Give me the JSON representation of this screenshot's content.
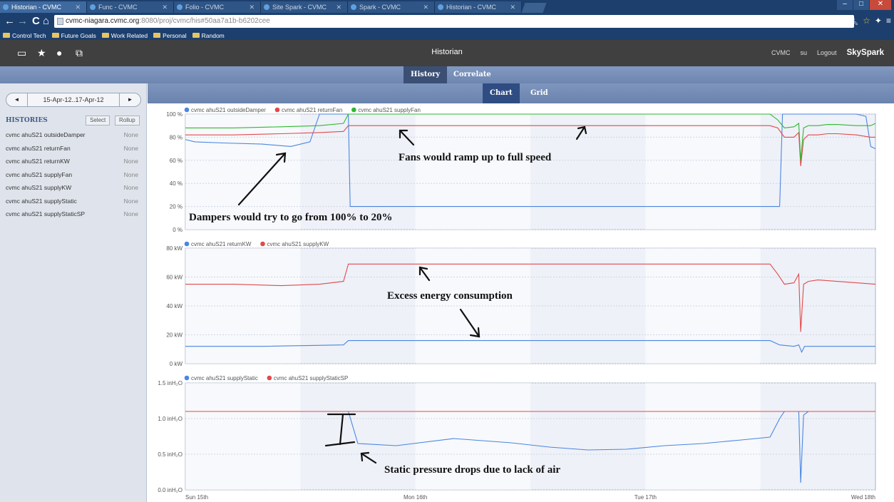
{
  "browser": {
    "tabs": [
      "Historian - CVMC",
      "Func - CVMC",
      "Folio - CVMC",
      "Site Spark - CVMC",
      "Spark - CVMC",
      "Historian - CVMC"
    ],
    "url_host": "cvmc-niagara.cvmc.org",
    "url_path": ":8080/proj/cvmc/his#50aa7a1b-b6202cee",
    "bookmarks": [
      "Control Tech",
      "Future Goals",
      "Work Related",
      "Personal",
      "Random"
    ]
  },
  "app": {
    "title": "Historian",
    "project": "CVMC",
    "user": "su",
    "logout": "Logout",
    "brand": "SkySpark",
    "mode_tabs": [
      "History",
      "Correlate"
    ],
    "view_tabs": [
      "Chart",
      "Grid"
    ]
  },
  "sidebar": {
    "date_range": "15-Apr-12..17-Apr-12",
    "histories_title": "HISTORIES",
    "select_label": "Select",
    "rollup_label": "Rollup",
    "items": [
      {
        "name": "cvmc ahuS21 outsideDamper",
        "rollup": "None"
      },
      {
        "name": "cvmc ahuS21 returnFan",
        "rollup": "None"
      },
      {
        "name": "cvmc ahuS21 returnKW",
        "rollup": "None"
      },
      {
        "name": "cvmc ahuS21 supplyFan",
        "rollup": "None"
      },
      {
        "name": "cvmc ahuS21 supplyKW",
        "rollup": "None"
      },
      {
        "name": "cvmc ahuS21 supplyStatic",
        "rollup": "None"
      },
      {
        "name": "cvmc ahuS21 supplyStaticSP",
        "rollup": "None"
      }
    ]
  },
  "colors": {
    "blue": "#4a86e0",
    "red": "#e04a4a",
    "green": "#2fb82f"
  },
  "chart_data": [
    {
      "type": "line",
      "ylim": [
        0,
        100
      ],
      "yticks": [
        "0 %",
        "20 %",
        "40 %",
        "60 %",
        "80 %",
        "100 %"
      ],
      "xlim": [
        0,
        72
      ],
      "series": [
        {
          "name": "cvmc ahuS21 outsideDamper",
          "color": "#4a86e0",
          "x": [
            0,
            1,
            4,
            8,
            11,
            13,
            14,
            15,
            16.5,
            17,
            17.2,
            18,
            26,
            34,
            42,
            50,
            58,
            62,
            62.3,
            62.6,
            63,
            64,
            66,
            67,
            68,
            69,
            70,
            71,
            71.5,
            72
          ],
          "y": [
            78,
            76,
            75,
            74,
            72,
            76,
            100,
            100,
            100,
            100,
            20,
            20,
            20,
            20,
            20,
            20,
            20,
            20,
            100,
            100,
            100,
            100,
            100,
            100,
            100,
            100,
            100,
            98,
            72,
            70
          ]
        },
        {
          "name": "cvmc ahuS21 returnFan",
          "color": "#e04a4a",
          "x": [
            0,
            5,
            10,
            14,
            16.5,
            17,
            30,
            45,
            61,
            61.8,
            62.5,
            63.5,
            64,
            64.2,
            64.5,
            65,
            66,
            67,
            68,
            70,
            71.5,
            72
          ],
          "y": [
            82,
            82,
            83,
            84,
            85,
            90,
            90,
            90,
            90,
            88,
            80,
            80,
            84,
            55,
            78,
            82,
            82,
            83,
            83,
            82,
            80,
            80
          ]
        },
        {
          "name": "cvmc ahuS21 supplyFan",
          "color": "#2fb82f",
          "x": [
            0,
            5,
            10,
            14,
            16.5,
            17,
            30,
            45,
            61,
            61.8,
            62.5,
            63.5,
            64,
            64.2,
            64.5,
            65,
            66,
            67,
            68,
            70,
            71.5,
            72
          ],
          "y": [
            88,
            88,
            89,
            90,
            92,
            100,
            100,
            100,
            100,
            95,
            88,
            89,
            92,
            60,
            88,
            90,
            90,
            91,
            91,
            90,
            90,
            92
          ]
        }
      ]
    },
    {
      "type": "line",
      "ylim": [
        0,
        80
      ],
      "yticks": [
        "0 kW",
        "20 kW",
        "40 kW",
        "60 kW",
        "80 kW"
      ],
      "xlim": [
        0,
        72
      ],
      "series": [
        {
          "name": "cvmc ahuS21 returnKW",
          "color": "#4a86e0",
          "x": [
            0,
            8,
            16.5,
            17,
            40,
            61,
            62,
            63.5,
            64,
            64.3,
            64.6,
            66,
            72
          ],
          "y": [
            12,
            12,
            13,
            16,
            16,
            16,
            13,
            12,
            13,
            8,
            12,
            12,
            12
          ]
        },
        {
          "name": "cvmc ahuS21 supplyKW",
          "color": "#e04a4a",
          "x": [
            0,
            5,
            10,
            14,
            16.5,
            17,
            40,
            61,
            61.8,
            62.5,
            63.5,
            64,
            64.2,
            64.5,
            65,
            66,
            68,
            70,
            72
          ],
          "y": [
            55,
            55,
            54,
            55,
            57,
            69,
            69,
            69,
            62,
            55,
            56,
            62,
            22,
            55,
            57,
            58,
            57,
            56,
            55
          ]
        }
      ]
    },
    {
      "type": "line",
      "ylim": [
        0,
        1.5
      ],
      "yticks": [
        "0.0 inH₂O",
        "0.5 inH₂O",
        "1.0 inH₂O",
        "1.5 inH₂O"
      ],
      "xlim": [
        0,
        72
      ],
      "xticks": [
        "Sun 15th",
        "Mon 16th",
        "Tue 17th",
        "Wed 18th"
      ],
      "series": [
        {
          "name": "cvmc ahuS21 supplyStatic",
          "color": "#4a86e0",
          "x": [
            0,
            16.5,
            17,
            18,
            22,
            28,
            34,
            38,
            42,
            46,
            50,
            54,
            58,
            61,
            62,
            62.5,
            63.5,
            64,
            64.2,
            64.5,
            65,
            66,
            68,
            72
          ],
          "y": [
            1.1,
            1.1,
            1.1,
            0.65,
            0.62,
            0.72,
            0.66,
            0.6,
            0.56,
            0.57,
            0.62,
            0.65,
            0.7,
            0.74,
            1.0,
            1.1,
            1.1,
            1.1,
            0.1,
            1.05,
            1.1,
            1.1,
            1.1,
            1.1
          ]
        },
        {
          "name": "cvmc ahuS21 supplyStaticSP",
          "color": "#e04a4a",
          "x": [
            0,
            72
          ],
          "y": [
            1.1,
            1.1
          ]
        }
      ]
    }
  ],
  "annotations": {
    "fans": "Fans would ramp up to full speed",
    "dampers": "Dampers would try to go from 100% to 20%",
    "energy": "Excess energy consumption",
    "static": "Static pressure drops due to lack of air"
  }
}
